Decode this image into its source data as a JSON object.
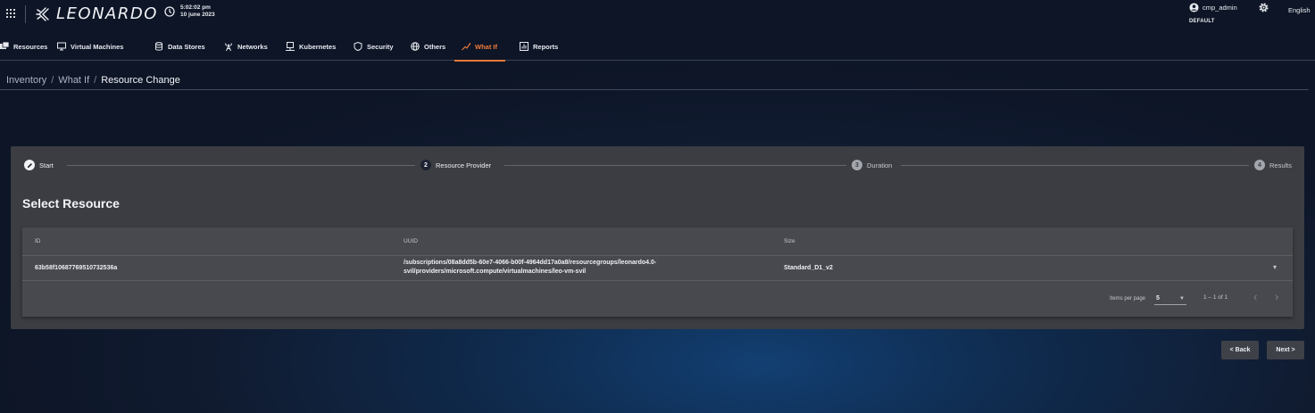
{
  "header": {
    "brand": "LEONARDO",
    "time": "5:02:02 pm",
    "date": "10 june 2023",
    "user_name": "cmp_admin",
    "tenant": "DEFAULT",
    "language": "English"
  },
  "nav": {
    "items": [
      {
        "label": "Resources",
        "icon": "server-stack-icon"
      },
      {
        "label": "Virtual Machines",
        "icon": "monitor-icon"
      },
      {
        "label": "Data Stores",
        "icon": "database-icon"
      },
      {
        "label": "Networks",
        "icon": "antenna-icon"
      },
      {
        "label": "Kubernetes",
        "icon": "cluster-icon"
      },
      {
        "label": "Security",
        "icon": "shield-icon"
      },
      {
        "label": "Others",
        "icon": "globe-icon"
      },
      {
        "label": "What If",
        "icon": "trend-icon",
        "active": true
      },
      {
        "label": "Reports",
        "icon": "report-icon"
      }
    ]
  },
  "breadcrumb": {
    "items": [
      "Inventory",
      "What If",
      "Resource Change"
    ],
    "separator": "/"
  },
  "stepper": {
    "steps": [
      {
        "number": "",
        "label": "Start",
        "state": "edit"
      },
      {
        "number": "2",
        "label": "Resource Provider",
        "state": "current"
      },
      {
        "number": "3",
        "label": "Duration",
        "state": "future"
      },
      {
        "number": "4",
        "label": "Results",
        "state": "future"
      }
    ]
  },
  "section": {
    "title": "Select Resource"
  },
  "table": {
    "columns": [
      "ID",
      "UUID",
      "Size"
    ],
    "rows": [
      {
        "id": "63b58f10687769510732536a",
        "uuid_line1": "/subscriptions/08a8dd5b-60e7-4066-b00f-4964dd17a0a8/resourcegroups/leonardo4.0-",
        "uuid_line2": "svil/providers/microsoft.compute/virtualmachines/leo-vm-svil",
        "size": "Standard_D1_v2"
      }
    ]
  },
  "paginator": {
    "label": "Items per page",
    "page_size": "5",
    "range": "1 – 1 of 1"
  },
  "actions": {
    "back": "< Back",
    "next": "Next >"
  },
  "colors": {
    "accent": "#ef7a3a",
    "card": "#3b3d42",
    "table": "#48494e"
  }
}
